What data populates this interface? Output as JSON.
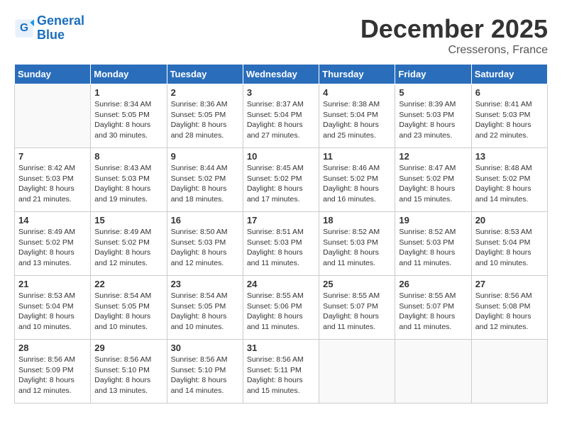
{
  "header": {
    "logo_line1": "General",
    "logo_line2": "Blue",
    "month": "December 2025",
    "location": "Cresserons, France"
  },
  "columns": [
    "Sunday",
    "Monday",
    "Tuesday",
    "Wednesday",
    "Thursday",
    "Friday",
    "Saturday"
  ],
  "weeks": [
    [
      {
        "day": "",
        "info": ""
      },
      {
        "day": "1",
        "info": "Sunrise: 8:34 AM\nSunset: 5:05 PM\nDaylight: 8 hours\nand 30 minutes."
      },
      {
        "day": "2",
        "info": "Sunrise: 8:36 AM\nSunset: 5:05 PM\nDaylight: 8 hours\nand 28 minutes."
      },
      {
        "day": "3",
        "info": "Sunrise: 8:37 AM\nSunset: 5:04 PM\nDaylight: 8 hours\nand 27 minutes."
      },
      {
        "day": "4",
        "info": "Sunrise: 8:38 AM\nSunset: 5:04 PM\nDaylight: 8 hours\nand 25 minutes."
      },
      {
        "day": "5",
        "info": "Sunrise: 8:39 AM\nSunset: 5:03 PM\nDaylight: 8 hours\nand 23 minutes."
      },
      {
        "day": "6",
        "info": "Sunrise: 8:41 AM\nSunset: 5:03 PM\nDaylight: 8 hours\nand 22 minutes."
      }
    ],
    [
      {
        "day": "7",
        "info": "Sunrise: 8:42 AM\nSunset: 5:03 PM\nDaylight: 8 hours\nand 21 minutes."
      },
      {
        "day": "8",
        "info": "Sunrise: 8:43 AM\nSunset: 5:03 PM\nDaylight: 8 hours\nand 19 minutes."
      },
      {
        "day": "9",
        "info": "Sunrise: 8:44 AM\nSunset: 5:02 PM\nDaylight: 8 hours\nand 18 minutes."
      },
      {
        "day": "10",
        "info": "Sunrise: 8:45 AM\nSunset: 5:02 PM\nDaylight: 8 hours\nand 17 minutes."
      },
      {
        "day": "11",
        "info": "Sunrise: 8:46 AM\nSunset: 5:02 PM\nDaylight: 8 hours\nand 16 minutes."
      },
      {
        "day": "12",
        "info": "Sunrise: 8:47 AM\nSunset: 5:02 PM\nDaylight: 8 hours\nand 15 minutes."
      },
      {
        "day": "13",
        "info": "Sunrise: 8:48 AM\nSunset: 5:02 PM\nDaylight: 8 hours\nand 14 minutes."
      }
    ],
    [
      {
        "day": "14",
        "info": "Sunrise: 8:49 AM\nSunset: 5:02 PM\nDaylight: 8 hours\nand 13 minutes."
      },
      {
        "day": "15",
        "info": "Sunrise: 8:49 AM\nSunset: 5:02 PM\nDaylight: 8 hours\nand 12 minutes."
      },
      {
        "day": "16",
        "info": "Sunrise: 8:50 AM\nSunset: 5:03 PM\nDaylight: 8 hours\nand 12 minutes."
      },
      {
        "day": "17",
        "info": "Sunrise: 8:51 AM\nSunset: 5:03 PM\nDaylight: 8 hours\nand 11 minutes."
      },
      {
        "day": "18",
        "info": "Sunrise: 8:52 AM\nSunset: 5:03 PM\nDaylight: 8 hours\nand 11 minutes."
      },
      {
        "day": "19",
        "info": "Sunrise: 8:52 AM\nSunset: 5:03 PM\nDaylight: 8 hours\nand 11 minutes."
      },
      {
        "day": "20",
        "info": "Sunrise: 8:53 AM\nSunset: 5:04 PM\nDaylight: 8 hours\nand 10 minutes."
      }
    ],
    [
      {
        "day": "21",
        "info": "Sunrise: 8:53 AM\nSunset: 5:04 PM\nDaylight: 8 hours\nand 10 minutes."
      },
      {
        "day": "22",
        "info": "Sunrise: 8:54 AM\nSunset: 5:05 PM\nDaylight: 8 hours\nand 10 minutes."
      },
      {
        "day": "23",
        "info": "Sunrise: 8:54 AM\nSunset: 5:05 PM\nDaylight: 8 hours\nand 10 minutes."
      },
      {
        "day": "24",
        "info": "Sunrise: 8:55 AM\nSunset: 5:06 PM\nDaylight: 8 hours\nand 11 minutes."
      },
      {
        "day": "25",
        "info": "Sunrise: 8:55 AM\nSunset: 5:07 PM\nDaylight: 8 hours\nand 11 minutes."
      },
      {
        "day": "26",
        "info": "Sunrise: 8:55 AM\nSunset: 5:07 PM\nDaylight: 8 hours\nand 11 minutes."
      },
      {
        "day": "27",
        "info": "Sunrise: 8:56 AM\nSunset: 5:08 PM\nDaylight: 8 hours\nand 12 minutes."
      }
    ],
    [
      {
        "day": "28",
        "info": "Sunrise: 8:56 AM\nSunset: 5:09 PM\nDaylight: 8 hours\nand 12 minutes."
      },
      {
        "day": "29",
        "info": "Sunrise: 8:56 AM\nSunset: 5:10 PM\nDaylight: 8 hours\nand 13 minutes."
      },
      {
        "day": "30",
        "info": "Sunrise: 8:56 AM\nSunset: 5:10 PM\nDaylight: 8 hours\nand 14 minutes."
      },
      {
        "day": "31",
        "info": "Sunrise: 8:56 AM\nSunset: 5:11 PM\nDaylight: 8 hours\nand 15 minutes."
      },
      {
        "day": "",
        "info": ""
      },
      {
        "day": "",
        "info": ""
      },
      {
        "day": "",
        "info": ""
      }
    ]
  ]
}
